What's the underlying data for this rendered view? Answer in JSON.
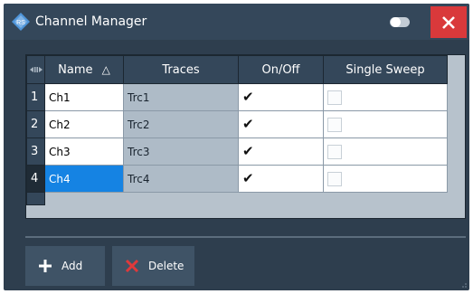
{
  "window": {
    "title": "Channel Manager"
  },
  "table": {
    "columns": [
      "Name",
      "Traces",
      "On/Off",
      "Single Sweep"
    ],
    "sort_indicator": "△",
    "rows": [
      {
        "index": "1",
        "name": "Ch1",
        "trace": "Trc1",
        "on": true,
        "single": false,
        "selected": false
      },
      {
        "index": "2",
        "name": "Ch2",
        "trace": "Trc2",
        "on": true,
        "single": false,
        "selected": false
      },
      {
        "index": "3",
        "name": "Ch3",
        "trace": "Trc3",
        "on": true,
        "single": false,
        "selected": false
      },
      {
        "index": "4",
        "name": "Ch4",
        "trace": "Trc4",
        "on": true,
        "single": false,
        "selected": true
      }
    ]
  },
  "buttons": {
    "add_label": "Add",
    "delete_label": "Delete"
  },
  "colors": {
    "window_bg": "#2e3e4e",
    "close_red": "#d9393b",
    "selection_blue": "#1583e3",
    "trace_cell": "#aebbc7"
  },
  "icons": {
    "logo": "rohde-schwarz-logo-icon",
    "toggle": "toggle-switch-icon",
    "close": "close-icon",
    "add": "plus-icon",
    "delete": "delete-x-icon",
    "column_resize": "column-resize-icon",
    "check": "checkmark-icon"
  }
}
